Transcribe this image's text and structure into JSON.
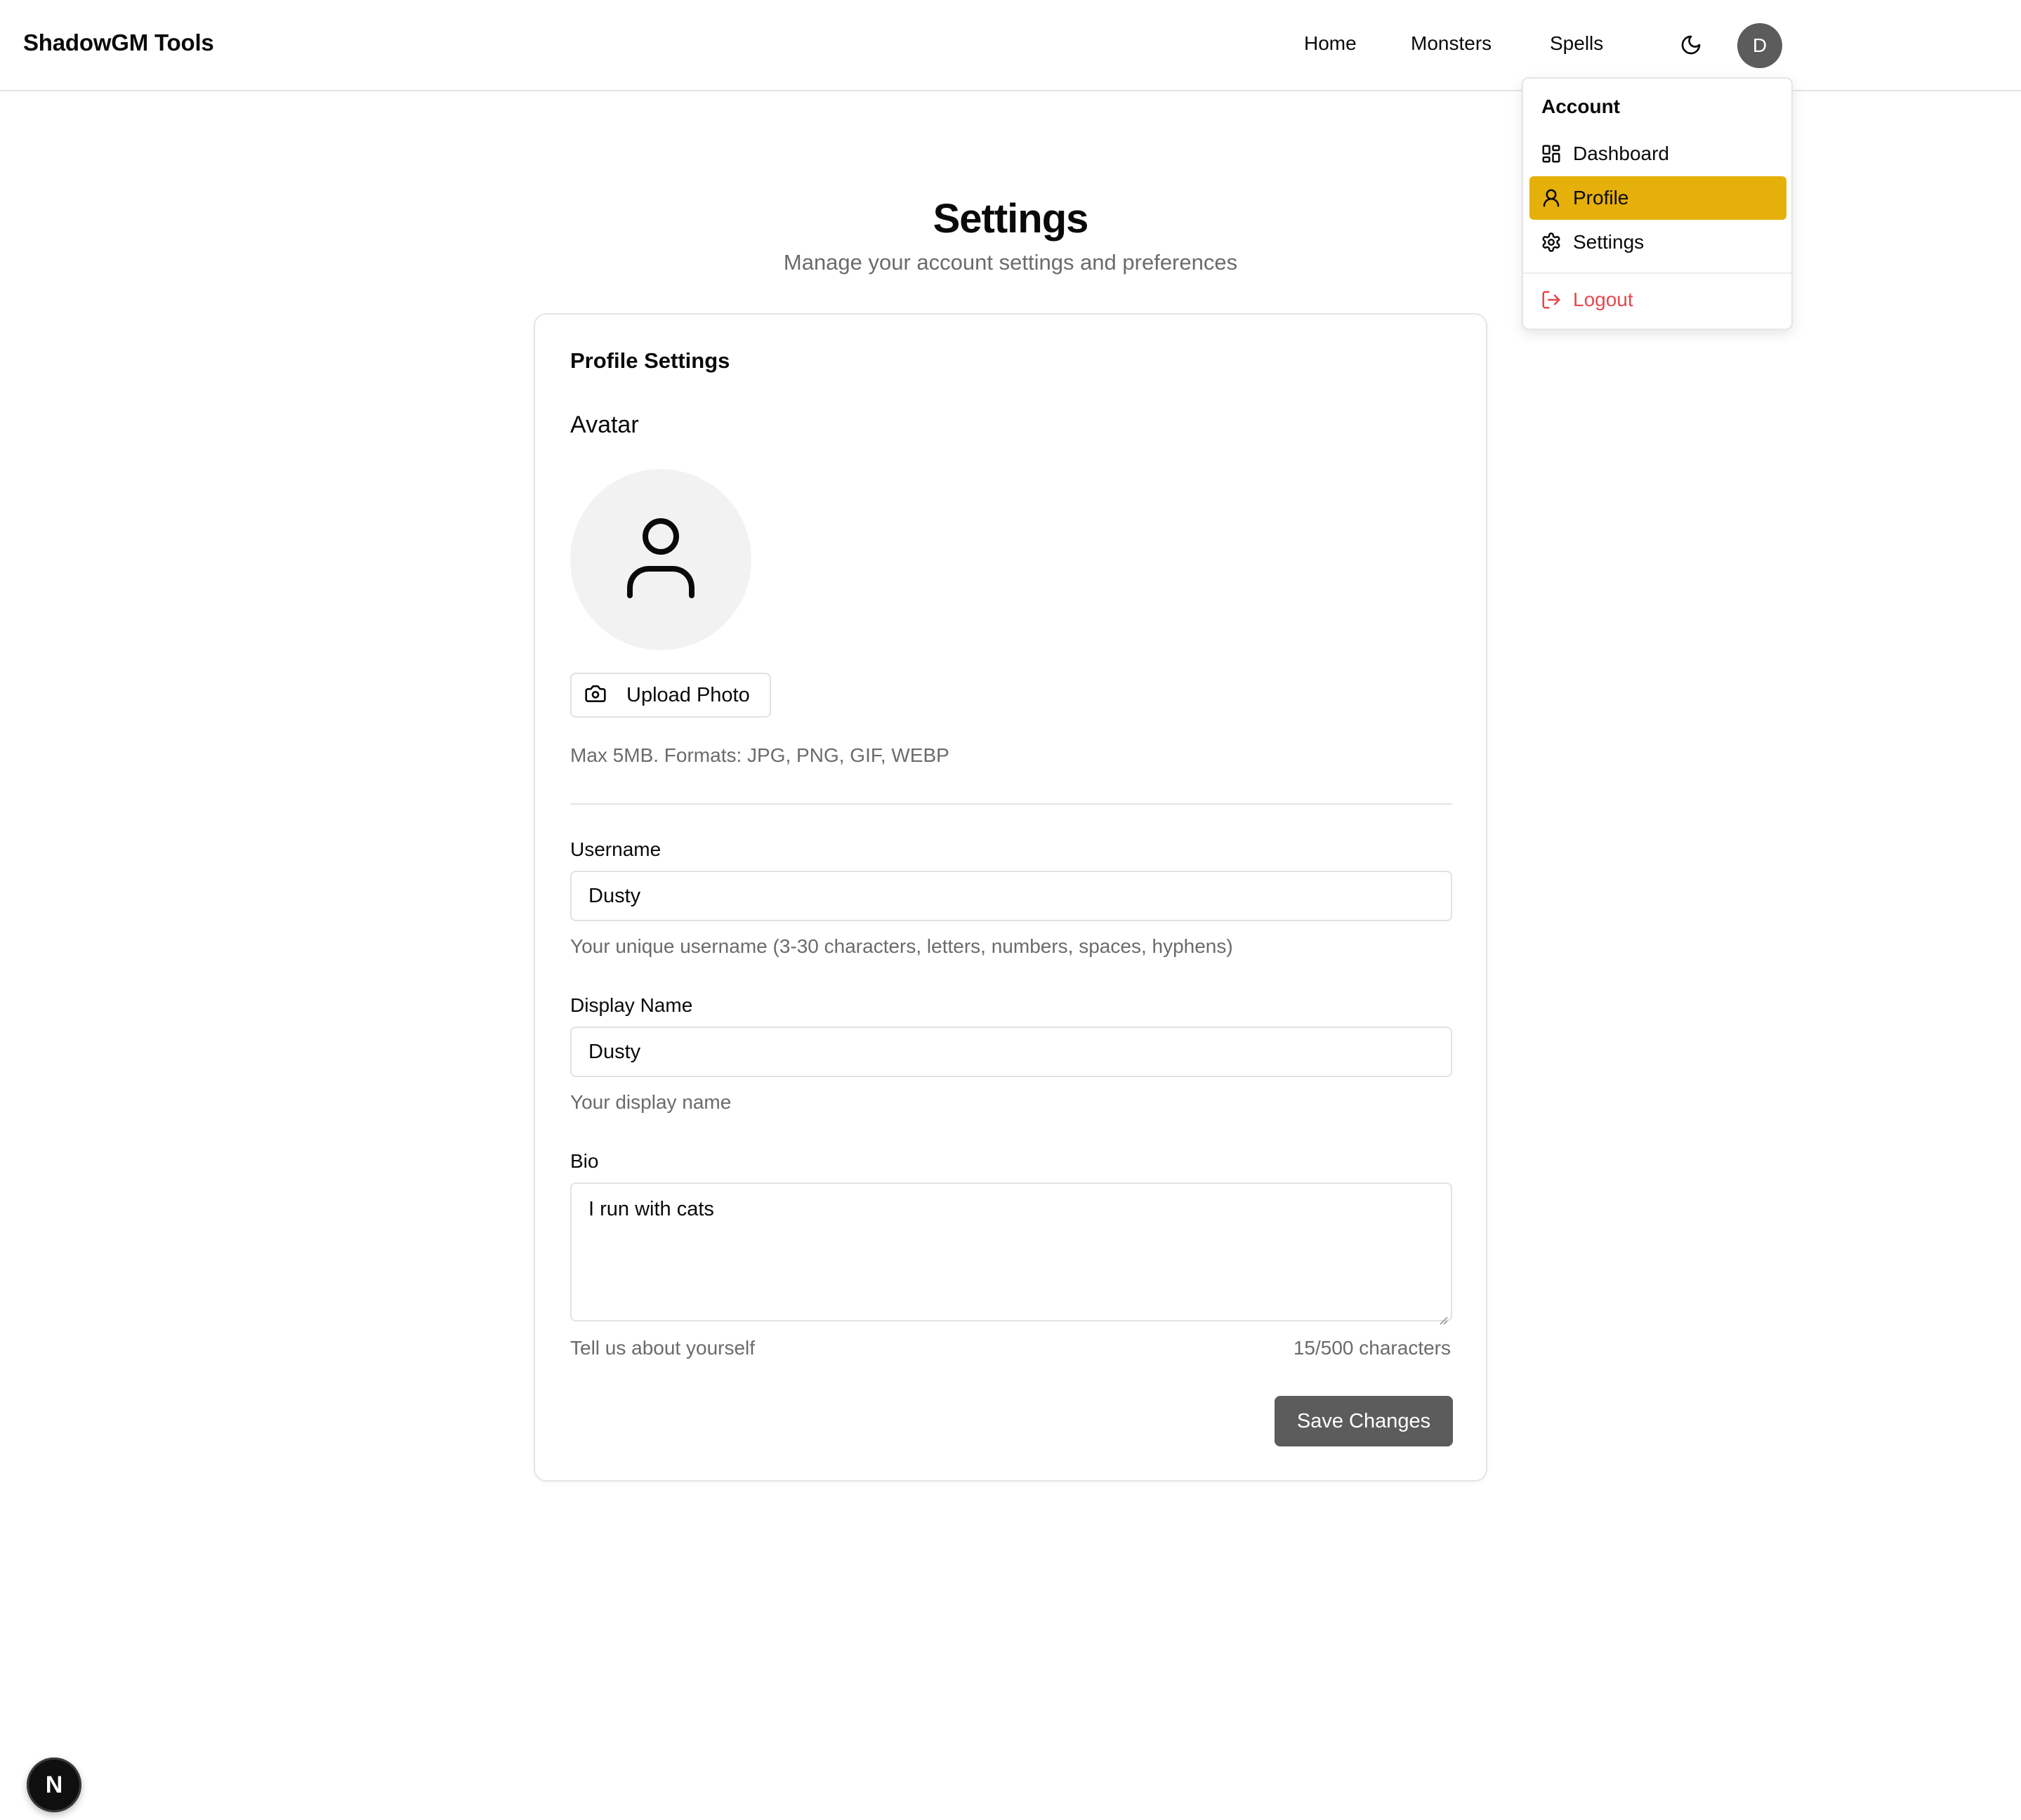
{
  "header": {
    "brand": "ShadowGM Tools",
    "nav": [
      "Home",
      "Monsters",
      "Spells"
    ],
    "avatar_initial": "D"
  },
  "account_menu": {
    "label": "Account",
    "items": [
      {
        "label": "Dashboard",
        "icon": "dashboard-icon"
      },
      {
        "label": "Profile",
        "icon": "user-icon",
        "active": true
      },
      {
        "label": "Settings",
        "icon": "gear-icon"
      }
    ],
    "logout": "Logout",
    "active_color": "#e6b00a",
    "logout_color": "#e5484d"
  },
  "page": {
    "title": "Settings",
    "subtitle": "Manage your account settings and preferences"
  },
  "profile_card": {
    "title": "Profile Settings",
    "avatar_label": "Avatar",
    "upload_button": "Upload Photo",
    "upload_hint": "Max 5MB. Formats: JPG, PNG, GIF, WEBP",
    "username": {
      "label": "Username",
      "value": "Dusty",
      "hint": "Your unique username (3-30 characters, letters, numbers, spaces, hyphens)"
    },
    "display_name": {
      "label": "Display Name",
      "value": "Dusty",
      "hint": "Your display name"
    },
    "bio": {
      "label": "Bio",
      "value": "I run with cats",
      "hint": "Tell us about yourself",
      "counter": "15/500 characters"
    },
    "save_button": "Save Changes"
  },
  "dev_badge": "N"
}
